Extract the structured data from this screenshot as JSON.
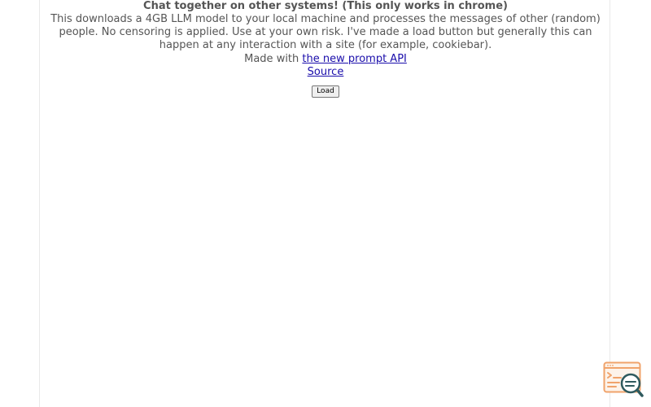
{
  "header": {
    "title": "Chat together on other systems! (This only works in chrome)"
  },
  "description": "This downloads a 4GB LLM model to your local machine and processes the messages of other (random) people. No censoring is applied. Use at your own risk. I've made a load button but generally this can happen at any interaction with a site (for example, cookiebar).",
  "made_with": {
    "prefix": "Made with",
    "link_label": "the new prompt API"
  },
  "source_link_label": "Source",
  "load_button_label": "Load",
  "colors": {
    "widget_orange": "#f0a36b",
    "widget_teal": "#2f5a5e"
  },
  "icons": {
    "widget": "chat-search-icon"
  }
}
